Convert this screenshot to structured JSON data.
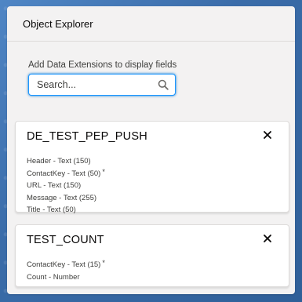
{
  "panel": {
    "title": "Object Explorer"
  },
  "search": {
    "label": "Add Data Extensions to display fields",
    "placeholder": "Search...",
    "icon": "search-icon"
  },
  "data_extensions": [
    {
      "name": "DE_TEST_PEP_PUSH",
      "close_icon": "close-icon",
      "fields": [
        {
          "label": "Header - Text (150)",
          "required": ""
        },
        {
          "label": "ContactKey - Text (50)",
          "required": "*"
        },
        {
          "label": "URL - Text (150)",
          "required": ""
        },
        {
          "label": "Message - Text (255)",
          "required": ""
        },
        {
          "label": "Title - Text (50)",
          "required": ""
        }
      ]
    },
    {
      "name": "TEST_COUNT",
      "close_icon": "close-icon",
      "fields": [
        {
          "label": "ContactKey - Text (15)",
          "required": "*"
        },
        {
          "label": "Count - Number",
          "required": ""
        }
      ]
    }
  ],
  "colors": {
    "page_background": "#3b6fae",
    "panel_background": "#f3f2f2",
    "card_background": "#ffffff",
    "focus_border": "#1b96ff"
  }
}
